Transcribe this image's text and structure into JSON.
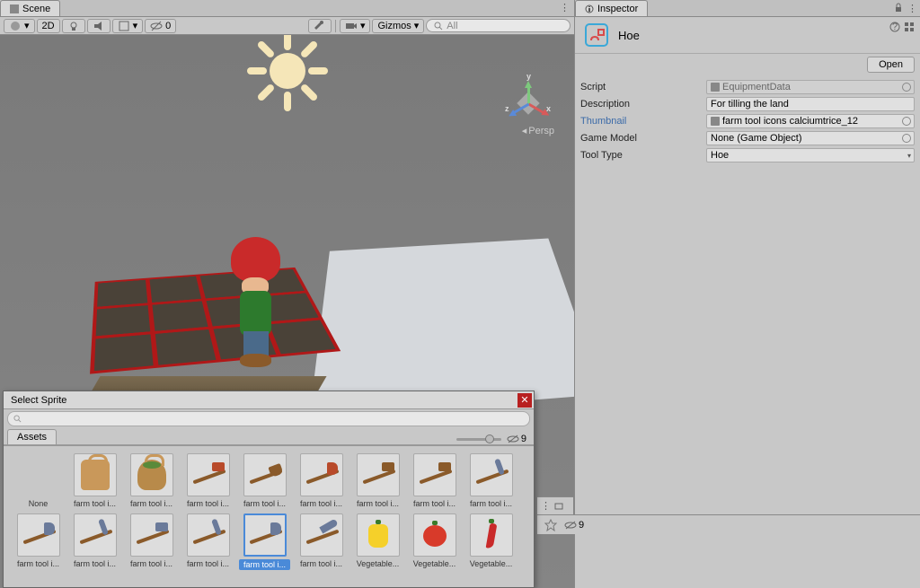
{
  "scene": {
    "tab_label": "Scene",
    "toolbar": {
      "shading_dd": "▾",
      "twod_label": "2D",
      "gizmos_label": "Gizmos",
      "search_placeholder": "All",
      "visibility_count": "0",
      "persp_label": "Persp",
      "axis_x": "x",
      "axis_y": "y",
      "axis_z": "z"
    }
  },
  "inspector": {
    "tab_label": "Inspector",
    "asset_name": "Hoe",
    "open_btn": "Open",
    "props": {
      "script_label": "Script",
      "script_value": "EquipmentData",
      "description_label": "Description",
      "description_value": "For tilling the land",
      "thumbnail_label": "Thumbnail",
      "thumbnail_value": "farm tool icons calciumtrice_12",
      "gamemodel_label": "Game Model",
      "gamemodel_value": "None (Game Object)",
      "tooltype_label": "Tool Type",
      "tooltype_value": "Hoe"
    }
  },
  "footer": {
    "visibility_count": "9"
  },
  "sprite_picker": {
    "title": "Select Sprite",
    "search_placeholder": "",
    "tab_assets": "Assets",
    "zoom_count": "9",
    "items": [
      {
        "label": "None",
        "type": "none"
      },
      {
        "label": "farm tool i...",
        "type": "bag1"
      },
      {
        "label": "farm tool i...",
        "type": "bag2"
      },
      {
        "label": "farm tool i...",
        "type": "shovel",
        "head": "#b84a2a"
      },
      {
        "label": "farm tool i...",
        "type": "pickaxe",
        "head": "#8a5a2a"
      },
      {
        "label": "farm tool i...",
        "type": "axe",
        "head": "#b84a2a"
      },
      {
        "label": "farm tool i...",
        "type": "hoe",
        "head": "#8a5a2a"
      },
      {
        "label": "farm tool i...",
        "type": "shovel2",
        "head": "#8a5a2a"
      },
      {
        "label": "farm tool i...",
        "type": "pick2",
        "head": "#6a7a9a"
      },
      {
        "label": "farm tool i...",
        "type": "axe2",
        "head": "#6a7a9a"
      },
      {
        "label": "farm tool i...",
        "type": "pick3",
        "head": "#6a7a9a"
      },
      {
        "label": "farm tool i...",
        "type": "shovel3",
        "head": "#6a7a9a"
      },
      {
        "label": "farm tool i...",
        "type": "pick4",
        "head": "#6a7a9a"
      },
      {
        "label": "farm tool i...",
        "type": "axe3",
        "head": "#6a7a9a",
        "selected": true
      },
      {
        "label": "farm tool i...",
        "type": "scythe",
        "head": "#6a7a9a"
      },
      {
        "label": "Vegetable...",
        "type": "pepper-yellow",
        "color": "#f5d02a"
      },
      {
        "label": "Vegetable...",
        "type": "tomato",
        "color": "#d83a2a"
      },
      {
        "label": "Vegetable...",
        "type": "chili",
        "color": "#c92a2a"
      }
    ]
  }
}
